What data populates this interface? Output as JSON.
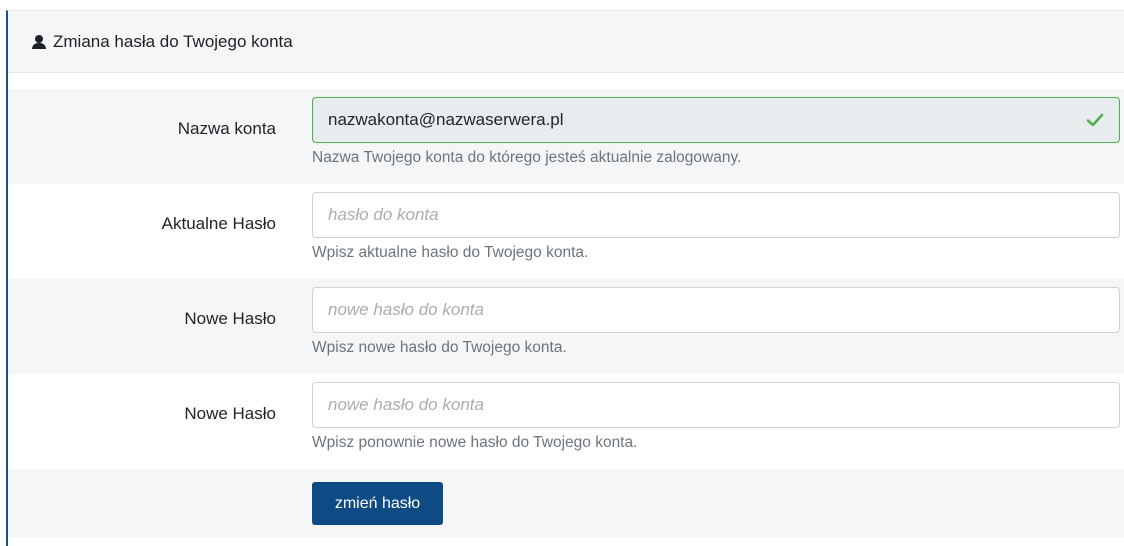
{
  "header": {
    "icon": "user-icon",
    "title": "Zmiana hasła do Twojego konta"
  },
  "fields": [
    {
      "label": "Nazwa konta",
      "value": "nazwakonta@nazwaserwera.pl",
      "placeholder": "",
      "help": "Nazwa Twojego konta do którego jesteś aktualnie zalogowany.",
      "status_icon": "check-icon",
      "status_color": "#4caf50"
    },
    {
      "label": "Aktualne Hasło",
      "value": "",
      "placeholder": "hasło do konta",
      "help": "Wpisz aktualne hasło do Twojego konta."
    },
    {
      "label": "Nowe Hasło",
      "value": "",
      "placeholder": "nowe hasło do konta",
      "help": "Wpisz nowe hasło do Twojego konta."
    },
    {
      "label": "Nowe Hasło",
      "value": "",
      "placeholder": "nowe hasło do konta",
      "help": "Wpisz ponownie nowe hasło do Twojego konta."
    }
  ],
  "submit": {
    "label": "zmień hasło",
    "color": "#0e4a83"
  }
}
